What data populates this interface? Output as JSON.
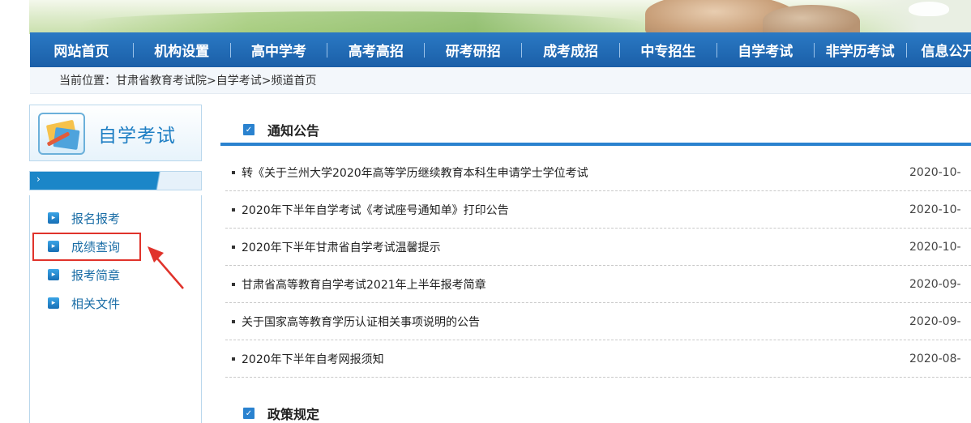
{
  "nav": {
    "items": [
      "网站首页",
      "机构设置",
      "高中学考",
      "高考高招",
      "研考研招",
      "成考成招",
      "中专招生",
      "自学考试",
      "非学历考试",
      "信息公开"
    ]
  },
  "breadcrumb": {
    "text": "当前位置：甘肃省教育考试院>自学考试>频道首页"
  },
  "sidebar": {
    "title": "自学考试",
    "items": [
      {
        "label": "报名报考"
      },
      {
        "label": "成绩查询"
      },
      {
        "label": "报考简章"
      },
      {
        "label": "相关文件"
      }
    ]
  },
  "notices": {
    "title": "通知公告",
    "items": [
      {
        "title": "转《关于兰州大学2020年高等学历继续教育本科生申请学士学位考试",
        "date": "2020-10-"
      },
      {
        "title": "2020年下半年自学考试《考试座号通知单》打印公告",
        "date": "2020-10-"
      },
      {
        "title": "2020年下半年甘肃省自学考试温馨提示",
        "date": "2020-10-"
      },
      {
        "title": "甘肃省高等教育自学考试2021年上半年报考简章",
        "date": "2020-09-"
      },
      {
        "title": "关于国家高等教育学历认证相关事项说明的公告",
        "date": "2020-09-"
      },
      {
        "title": "2020年下半年自考网报须知",
        "date": "2020-08-"
      }
    ]
  },
  "policy": {
    "title": "政策规定"
  },
  "colors": {
    "nav_bg": "#1b5fa8",
    "accent": "#2a82cf",
    "highlight": "#e0332b"
  }
}
